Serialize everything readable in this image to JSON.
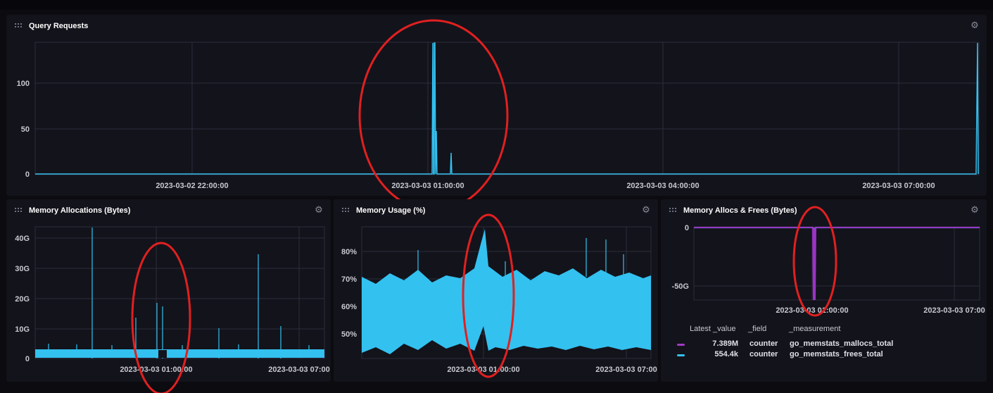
{
  "panels": {
    "query": {
      "title": "Query Requests",
      "y_ticks": [
        "100",
        "50",
        "0"
      ],
      "x_ticks": [
        "2023-03-02 22:00:00",
        "2023-03-03 01:00:00",
        "2023-03-03 04:00:00",
        "2023-03-03 07:00:00"
      ]
    },
    "mem_alloc": {
      "title": "Memory Allocations (Bytes)",
      "y_ticks": [
        "40G",
        "30G",
        "20G",
        "10G",
        "0"
      ],
      "x_ticks": [
        "2023-03-03 01:00:00",
        "2023-03-03 07:00"
      ]
    },
    "mem_usage": {
      "title": "Memory Usage (%)",
      "y_ticks": [
        "80%",
        "70%",
        "60%",
        "50%"
      ],
      "x_ticks": [
        "2023-03-03 01:00:00",
        "2023-03-03 07:00"
      ]
    },
    "allocs_frees": {
      "title": "Memory Allocs & Frees (Bytes)",
      "y_ticks": [
        "0",
        "-50G"
      ],
      "x_ticks": [
        "2023-03-03 01:00:00",
        "2023-03-03 07:00"
      ],
      "legend_headers": [
        "Latest _value",
        "_field",
        "_measurement"
      ],
      "legend_rows": [
        {
          "value": "7.389M",
          "field": "counter",
          "measurement": "go_memstats_mallocs_total",
          "color": "#a13ac4"
        },
        {
          "value": "554.4k",
          "field": "counter",
          "measurement": "go_memstats_frees_total",
          "color": "#33c1f0"
        }
      ]
    }
  },
  "colors": {
    "series": "#33c1f0",
    "series_purple": "#9b33c4",
    "annotation": "#e02020",
    "grid": "#2c2c3c"
  }
}
